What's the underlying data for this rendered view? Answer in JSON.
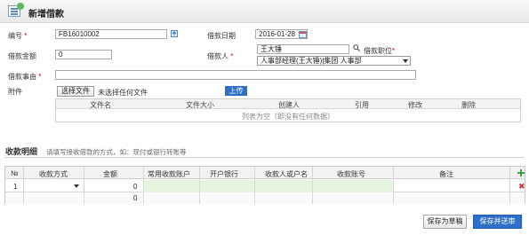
{
  "header": {
    "title": "新增借款"
  },
  "form": {
    "number": {
      "label": "编号",
      "value": "FB16010002"
    },
    "date": {
      "label": "借款日期",
      "value": "2016-01-28"
    },
    "amount": {
      "label": "借款金额",
      "value": "0"
    },
    "borrower": {
      "label": "借款人",
      "value": "王大锤"
    },
    "position": {
      "label": "借款职位",
      "value": "人事部经理(王大锤)|集团 人事部"
    },
    "reason": {
      "label": "借款事由",
      "value": ""
    },
    "attachment": {
      "label": "附件",
      "choose_button": "选择文件",
      "no_file_text": "未选择任何文件",
      "upload_button": "上传",
      "columns": [
        "文件名",
        "文件大小",
        "创建人",
        "引用",
        "修改",
        "删除"
      ],
      "empty_text": "列表为空（即没有任何数据）"
    }
  },
  "detail": {
    "title": "收款明细",
    "hint": "请填写接收借款的方式，如：现付或银行转账等",
    "columns": [
      "№",
      "收款方式",
      "金额",
      "常用收款账户",
      "开户银行",
      "收款人或户名",
      "收款账号",
      "备注"
    ],
    "rows": [
      {
        "no": "1",
        "method": "",
        "amount": "0",
        "account": "",
        "bank": "",
        "payee": "",
        "account_no": "",
        "note": ""
      }
    ],
    "total_amount": "0"
  },
  "buttons": {
    "save_draft": "保存为草稿",
    "save_submit": "保存并送审"
  },
  "colors": {
    "accent": "#2e6fc8",
    "required": "#dd0000",
    "green_cell": "#e5f5e0",
    "delete": "#d9302c"
  }
}
